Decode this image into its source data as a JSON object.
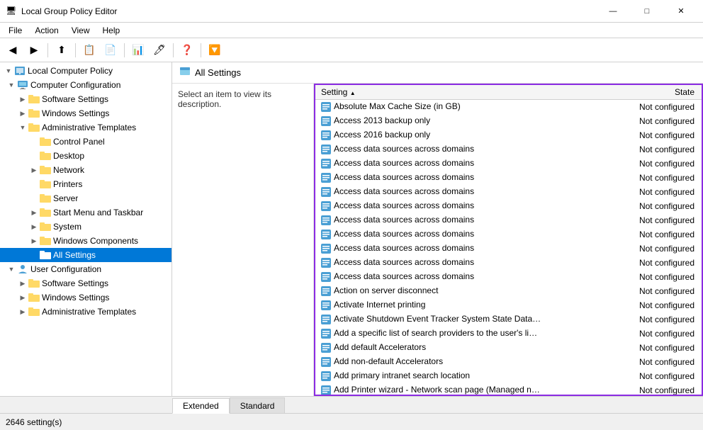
{
  "titleBar": {
    "icon": "🖥",
    "title": "Local Group Policy Editor",
    "buttons": {
      "minimize": "—",
      "maximize": "□",
      "close": "✕"
    }
  },
  "menuBar": {
    "items": [
      "File",
      "Action",
      "View",
      "Help"
    ]
  },
  "toolbar": {
    "buttons": [
      "◀",
      "▶",
      "⬆",
      "📋",
      "📄",
      "🔍",
      "⚙"
    ]
  },
  "sidebar": {
    "rootLabel": "Local Computer Policy",
    "tree": [
      {
        "id": "computer-config",
        "label": "Computer Configuration",
        "level": 1,
        "expanded": true,
        "icon": "computer"
      },
      {
        "id": "software-settings",
        "label": "Software Settings",
        "level": 2,
        "expanded": false,
        "icon": "folder"
      },
      {
        "id": "windows-settings",
        "label": "Windows Settings",
        "level": 2,
        "expanded": false,
        "icon": "folder"
      },
      {
        "id": "admin-templates",
        "label": "Administrative Templates",
        "level": 2,
        "expanded": true,
        "icon": "folder-open"
      },
      {
        "id": "control-panel",
        "label": "Control Panel",
        "level": 3,
        "expanded": false,
        "icon": "folder"
      },
      {
        "id": "desktop",
        "label": "Desktop",
        "level": 3,
        "expanded": false,
        "icon": "folder"
      },
      {
        "id": "network",
        "label": "Network",
        "level": 3,
        "expanded": true,
        "icon": "folder"
      },
      {
        "id": "printers",
        "label": "Printers",
        "level": 3,
        "expanded": false,
        "icon": "folder"
      },
      {
        "id": "server",
        "label": "Server",
        "level": 3,
        "expanded": false,
        "icon": "folder"
      },
      {
        "id": "start-menu",
        "label": "Start Menu and Taskbar",
        "level": 3,
        "expanded": false,
        "icon": "folder"
      },
      {
        "id": "system",
        "label": "System",
        "level": 3,
        "expanded": false,
        "icon": "folder"
      },
      {
        "id": "windows-components",
        "label": "Windows Components",
        "level": 3,
        "expanded": false,
        "icon": "folder"
      },
      {
        "id": "all-settings",
        "label": "All Settings",
        "level": 3,
        "expanded": false,
        "icon": "folder",
        "selected": true
      },
      {
        "id": "user-config",
        "label": "User Configuration",
        "level": 1,
        "expanded": true,
        "icon": "computer"
      },
      {
        "id": "software-settings-user",
        "label": "Software Settings",
        "level": 2,
        "expanded": false,
        "icon": "folder"
      },
      {
        "id": "windows-settings-user",
        "label": "Windows Settings",
        "level": 2,
        "expanded": false,
        "icon": "folder"
      },
      {
        "id": "admin-templates-user",
        "label": "Administrative Templates",
        "level": 2,
        "expanded": false,
        "icon": "folder"
      }
    ]
  },
  "contentHeader": {
    "icon": "📋",
    "title": "All Settings"
  },
  "descriptionPane": {
    "text": "Select an item to view its description."
  },
  "settingsTable": {
    "columns": [
      {
        "label": "Setting",
        "sortAsc": true
      },
      {
        "label": "State"
      }
    ],
    "rows": [
      {
        "setting": "Absolute Max Cache Size (in GB)",
        "state": "Not configured"
      },
      {
        "setting": "Access 2013 backup only",
        "state": "Not configured"
      },
      {
        "setting": "Access 2016 backup only",
        "state": "Not configured"
      },
      {
        "setting": "Access data sources across domains",
        "state": "Not configured"
      },
      {
        "setting": "Access data sources across domains",
        "state": "Not configured"
      },
      {
        "setting": "Access data sources across domains",
        "state": "Not configured"
      },
      {
        "setting": "Access data sources across domains",
        "state": "Not configured"
      },
      {
        "setting": "Access data sources across domains",
        "state": "Not configured"
      },
      {
        "setting": "Access data sources across domains",
        "state": "Not configured"
      },
      {
        "setting": "Access data sources across domains",
        "state": "Not configured"
      },
      {
        "setting": "Access data sources across domains",
        "state": "Not configured"
      },
      {
        "setting": "Access data sources across domains",
        "state": "Not configured"
      },
      {
        "setting": "Access data sources across domains",
        "state": "Not configured"
      },
      {
        "setting": "Action on server disconnect",
        "state": "Not configured"
      },
      {
        "setting": "Activate Internet printing",
        "state": "Not configured"
      },
      {
        "setting": "Activate Shutdown Event Tracker System State Data feature",
        "state": "Not configured"
      },
      {
        "setting": "Add a specific list of search providers to the user's list of sea...",
        "state": "Not configured"
      },
      {
        "setting": "Add default Accelerators",
        "state": "Not configured"
      },
      {
        "setting": "Add non-default Accelerators",
        "state": "Not configured"
      },
      {
        "setting": "Add primary intranet search location",
        "state": "Not configured"
      },
      {
        "setting": "Add Printer wizard - Network scan page (Managed network)",
        "state": "Not configured"
      }
    ]
  },
  "tabs": [
    {
      "label": "Extended",
      "active": true
    },
    {
      "label": "Standard",
      "active": false
    }
  ],
  "statusBar": {
    "text": "2646 setting(s)"
  }
}
